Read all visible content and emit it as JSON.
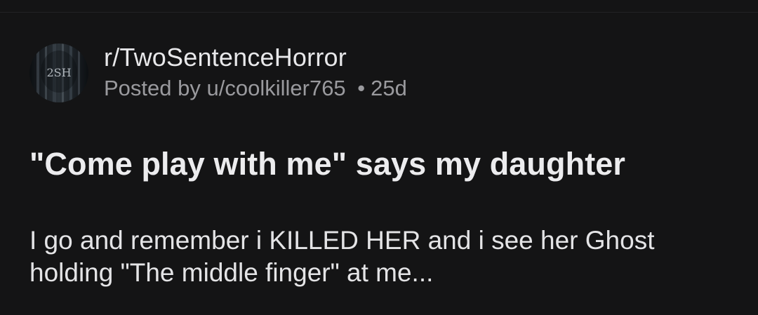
{
  "post": {
    "subreddit": "r/TwoSentenceHorror",
    "avatar_text": "2SH",
    "posted_by_prefix": "Posted by",
    "author": "u/coolkiller765",
    "separator": "•",
    "age": "25d",
    "title": "\"Come play with me\" says my daughter",
    "body": "I go and remember i KILLED HER and i see her Ghost holding \"The middle finger\" at me..."
  },
  "colors": {
    "background": "#141415",
    "primary_text": "#e8e8ea",
    "secondary_text": "#9a9a9e"
  }
}
